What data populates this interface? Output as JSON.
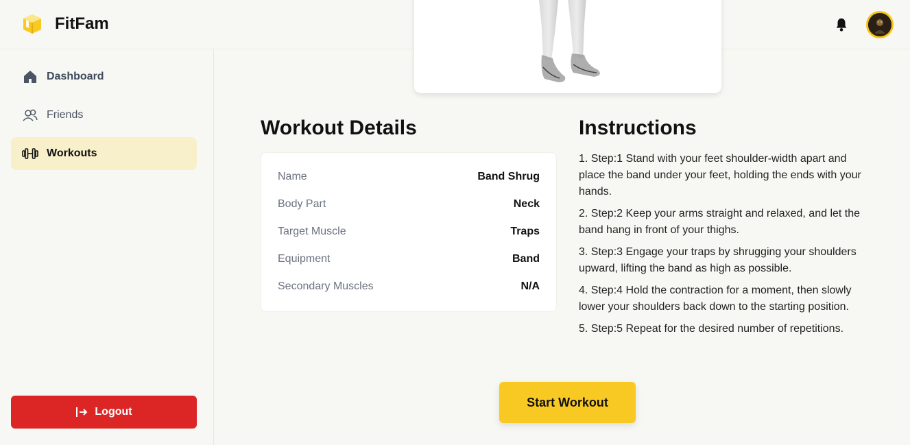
{
  "app": {
    "name": "FitFam",
    "logo_icon": "cube-logo-icon",
    "accent": "#f9c923"
  },
  "header": {
    "notification_icon": "bell-icon",
    "avatar_icon": "user-avatar"
  },
  "sidebar": {
    "items": [
      {
        "label": "Dashboard",
        "icon": "home-icon"
      },
      {
        "label": "Friends",
        "icon": "users-icon"
      },
      {
        "label": "Workouts",
        "icon": "dumbbell-icon",
        "active": true
      }
    ],
    "logout_label": "Logout",
    "logout_color": "#dc2626"
  },
  "details": {
    "title": "Workout Details",
    "rows": [
      {
        "key": "Name",
        "value": "Band Shrug"
      },
      {
        "key": "Body Part",
        "value": "Neck"
      },
      {
        "key": "Target Muscle",
        "value": "Traps"
      },
      {
        "key": "Equipment",
        "value": "Band"
      },
      {
        "key": "Secondary Muscles",
        "value": "N/A"
      }
    ]
  },
  "instructions": {
    "title": "Instructions",
    "steps": [
      "1. Step:1 Stand with your feet shoulder-width apart and place the band under your feet, holding the ends with your hands.",
      "2. Step:2 Keep your arms straight and relaxed, and let the band hang in front of your thighs.",
      "3. Step:3 Engage your traps by shrugging your shoulders upward, lifting the band as high as possible.",
      "4. Step:4 Hold the contraction for a moment, then slowly lower your shoulders back down to the starting position.",
      "5. Step:5 Repeat for the desired number of repetitions."
    ]
  },
  "actions": {
    "start_label": "Start Workout"
  }
}
